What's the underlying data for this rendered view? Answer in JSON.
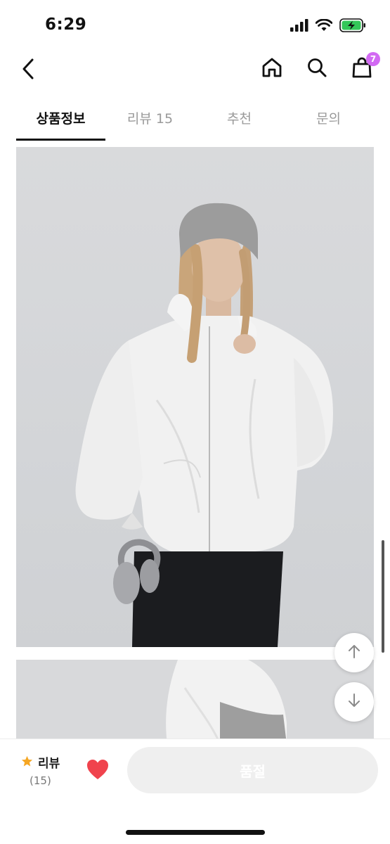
{
  "status_bar": {
    "time": "6:29",
    "icons": [
      "signal-icon",
      "wifi-icon",
      "battery-charging-icon"
    ],
    "battery_color": "#34c759"
  },
  "nav": {
    "icons": [
      "back-icon",
      "home-icon",
      "search-icon",
      "shopping-bag-icon"
    ],
    "cart_count": "7",
    "badge_color": "#d26af3"
  },
  "tabs": [
    {
      "label": "상품정보",
      "active": true
    },
    {
      "label": "리뷰 15",
      "active": false
    },
    {
      "label": "추천",
      "active": false
    },
    {
      "label": "문의",
      "active": false
    }
  ],
  "content": {
    "images": [
      "product-photo-white-windbreaker-front",
      "product-photo-hood-closeup"
    ]
  },
  "floating": {
    "icons": [
      "arrow-up-icon",
      "arrow-down-icon"
    ]
  },
  "bottom_bar": {
    "review_label": "리뷰",
    "review_count": "(15)",
    "star_color": "#f5a623",
    "heart_color": "#f0434d",
    "soldout_label": "품절"
  }
}
